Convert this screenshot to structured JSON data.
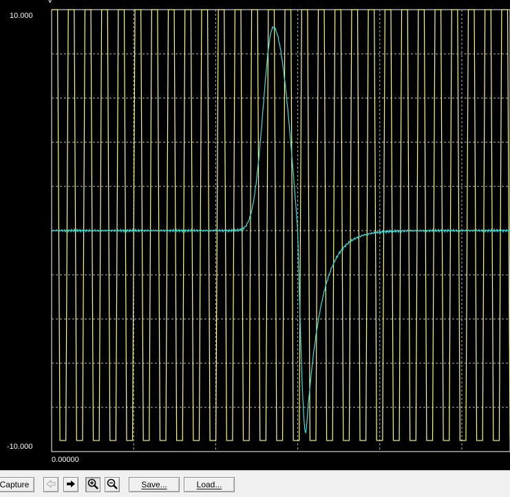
{
  "plot": {
    "y_unit": "V",
    "y_max_label": "10.000",
    "y_min_label": "-10.000",
    "x_start_label": "0.00000",
    "colors": {
      "background": "#000000",
      "grid": "#ffffff",
      "trace_square": "#ffff66",
      "trace_pulse": "#33e6e6"
    }
  },
  "chart_data": {
    "type": "line",
    "ylim": [
      -10,
      10
    ],
    "grid": true,
    "x_divisions": 5.6,
    "y_divisions": 10,
    "series": [
      {
        "kind": "square-wave",
        "high": 10,
        "low": -9.5,
        "cycles": 27.5,
        "x_start_div": 0
      },
      {
        "kind": "bipolar-pulse",
        "baseline": 0,
        "peak": 9.2,
        "trough": -9.2,
        "peak_div": 2.7,
        "zero_cross_div": 3.0,
        "trough_div": 3.1
      }
    ]
  },
  "toolbar": {
    "capture_label": "Capture",
    "back_icon": "arrow-left-icon",
    "forward_icon": "arrow-right-icon",
    "zoom_in_icon": "zoom-in-icon",
    "zoom_out_icon": "zoom-out-icon",
    "save_label": "Save...",
    "load_label": "Load..."
  }
}
